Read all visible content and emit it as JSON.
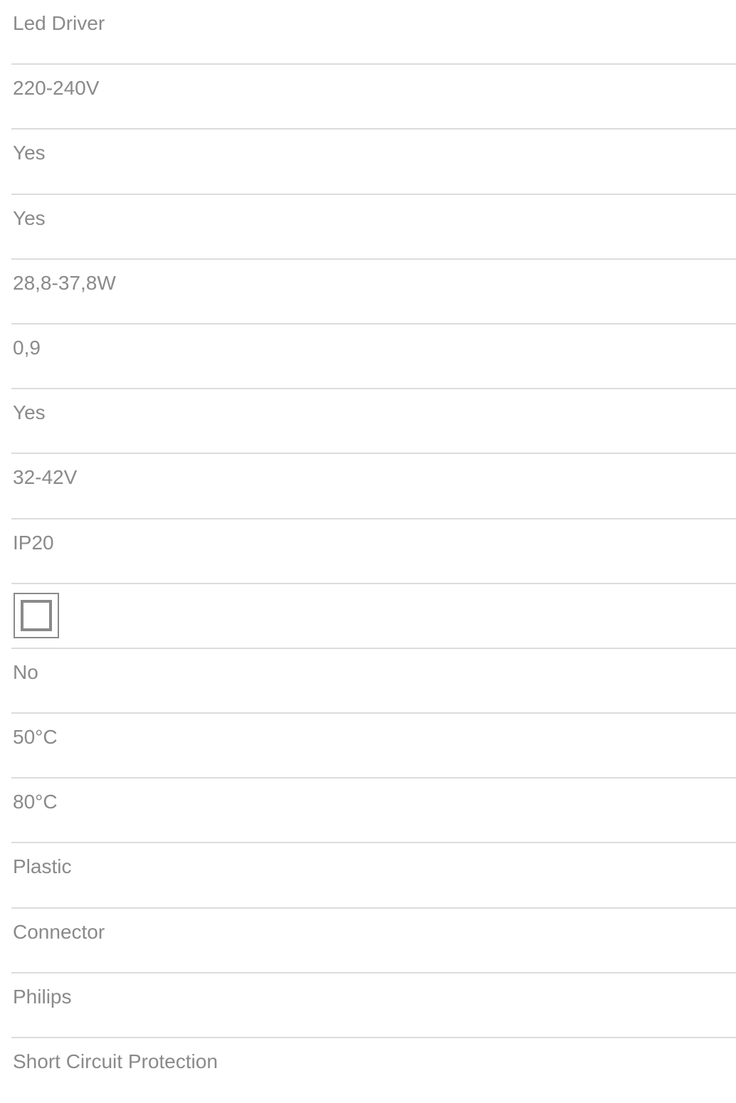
{
  "specs": [
    {
      "value": "Led Driver"
    },
    {
      "value": "220-240V"
    },
    {
      "value": "Yes"
    },
    {
      "value": "Yes"
    },
    {
      "value": "28,8-37,8W"
    },
    {
      "value": "0,9"
    },
    {
      "value": "Yes"
    },
    {
      "value": "32-42V"
    },
    {
      "value": "IP20"
    },
    {
      "icon": "class-ii-double-insulation-icon"
    },
    {
      "value": "No"
    },
    {
      "value": "50°C"
    },
    {
      "value": "80°C"
    },
    {
      "value": "Plastic"
    },
    {
      "value": "Connector"
    },
    {
      "value": "Philips"
    },
    {
      "value": "Short Circuit Protection"
    }
  ],
  "colors": {
    "text": "#8a8a8a",
    "divider": "#dcdcdc",
    "icon": "#8a8a8a"
  }
}
